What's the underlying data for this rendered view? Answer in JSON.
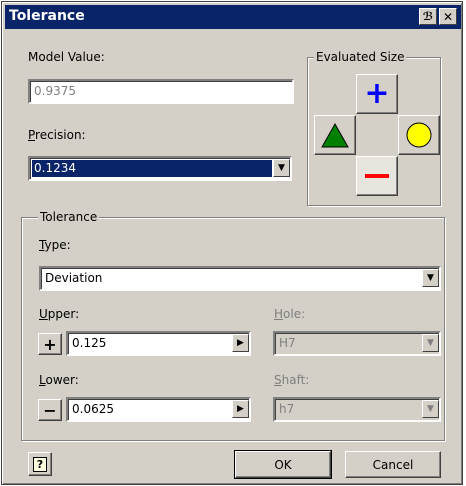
{
  "window": {
    "title": "Tolerance",
    "help_glyph": "?",
    "close_glyph": "✕"
  },
  "model_value": {
    "label": "Model Value:",
    "value": "0.9375"
  },
  "precision": {
    "label_first": "P",
    "label_rest": "recision:",
    "value": "0.1234"
  },
  "evaluated_size": {
    "label": "Evaluated Size",
    "buttons": [
      "plus-icon",
      "triangle-icon",
      "circle-icon",
      "minus-icon"
    ]
  },
  "tolerance": {
    "group_label": "Tolerance",
    "type": {
      "label_first": "T",
      "label_rest": "ype:",
      "value": "Deviation"
    },
    "upper": {
      "label_first": "U",
      "label_rest": "pper:",
      "sign": "+",
      "value": "0.125"
    },
    "lower": {
      "label_first": "L",
      "label_rest": "ower:",
      "sign": "−",
      "value": "0.0625"
    },
    "hole": {
      "label_first": "H",
      "label_rest": "ole:",
      "value": "H7"
    },
    "shaft": {
      "label_first": "S",
      "label_rest": "haft:",
      "value": "h7"
    }
  },
  "footer": {
    "help_glyph": "?",
    "ok_label": "OK",
    "cancel_label": "Cancel"
  },
  "colors": {
    "titlebar": "#0a246a",
    "selection": "#0a246a",
    "plus": "#0000ff",
    "minus": "#ff0000",
    "triangle": "#008000",
    "circle": "#ffff00"
  }
}
